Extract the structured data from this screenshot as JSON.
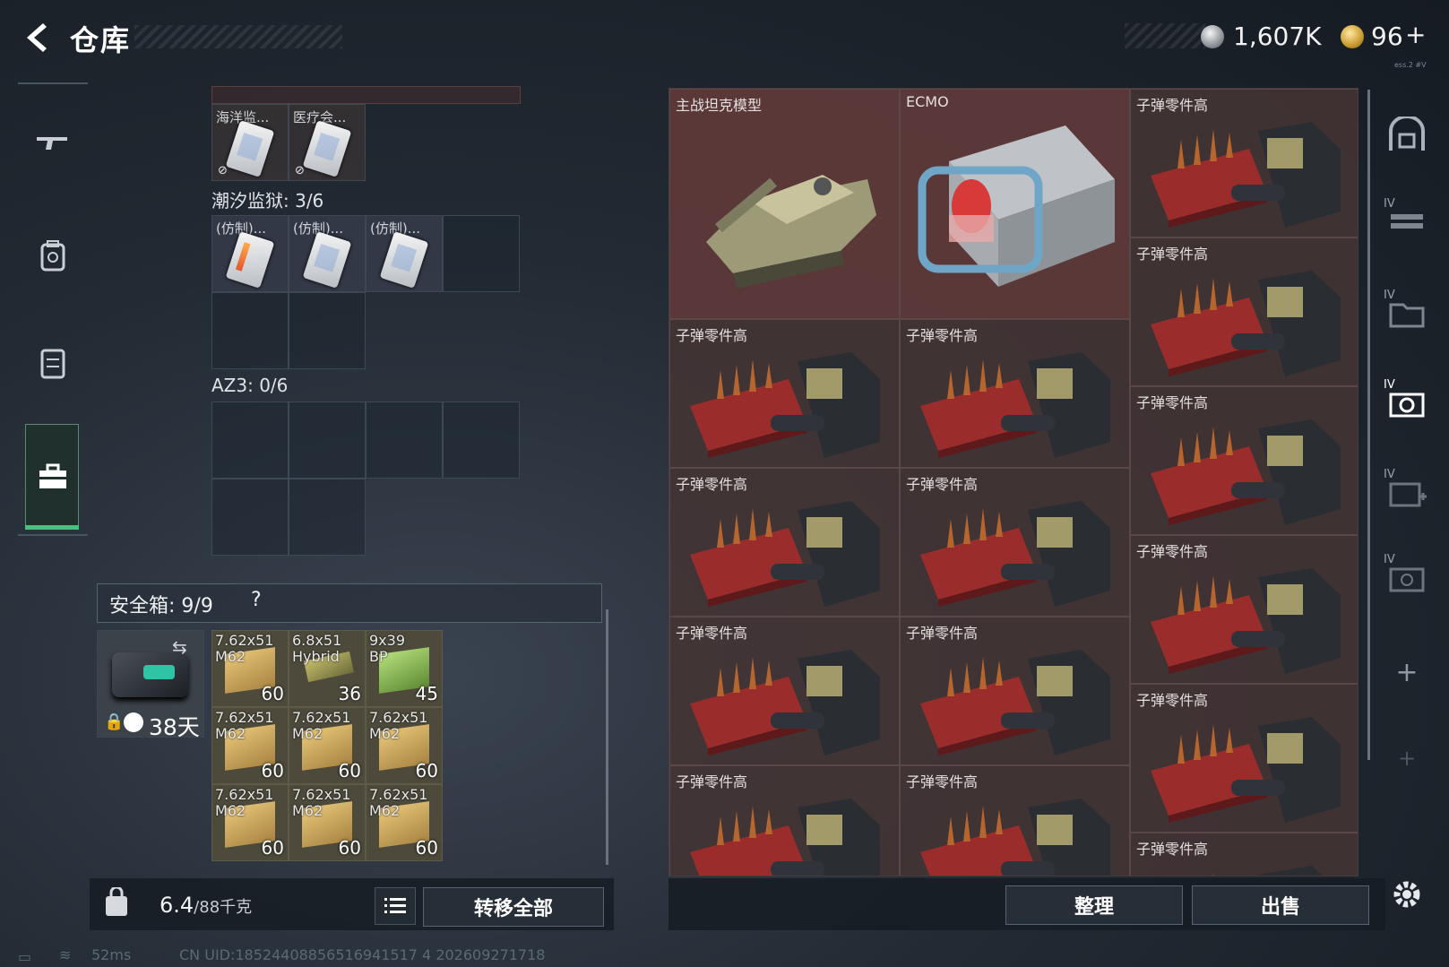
{
  "header": {
    "title": "仓库",
    "currency_silver": "1,607K",
    "currency_gold": "96",
    "gold_plus": "+",
    "version_text": "ess.2 #V"
  },
  "left_nav": {
    "items": [
      "weapon-icon",
      "backpack-icon",
      "vest-icon",
      "toolbox-icon"
    ],
    "active_index": 3
  },
  "containers": {
    "top_row": [
      {
        "label": "海洋监..."
      },
      {
        "label": "医疗会..."
      }
    ],
    "tidal": {
      "title": "潮汐监狱: 3/6",
      "items": [
        {
          "label": "(仿制)..."
        },
        {
          "label": "(仿制)..."
        },
        {
          "label": "(仿制)..."
        }
      ]
    },
    "az3": {
      "title": "AZ3: 0/6"
    }
  },
  "safe_box": {
    "label": "安全箱: 9/9",
    "help": "?",
    "days": "38天",
    "ammo": [
      {
        "name": "7.62x51\nM62",
        "count": "60"
      },
      {
        "name": "6.8x51\nHybrid",
        "count": "36"
      },
      {
        "name": "9x39\nBP",
        "count": "45"
      },
      {
        "name": "7.62x51\nM62",
        "count": "60"
      },
      {
        "name": "7.62x51\nM62",
        "count": "60"
      },
      {
        "name": "7.62x51\nM62",
        "count": "60"
      },
      {
        "name": "7.62x51\nM62",
        "count": "60"
      },
      {
        "name": "7.62x51\nM62",
        "count": "60"
      },
      {
        "name": "7.62x51\nM62",
        "count": "60"
      }
    ]
  },
  "bottom_left": {
    "weight_current": "6.4",
    "weight_max": "/88千克",
    "transfer_all": "转移全部"
  },
  "storage": {
    "tank": "主战坦克模型",
    "ecmo": "ECMO",
    "bullet_parts": "子弹零件高",
    "bullet_parts_count": 14
  },
  "bottom_right": {
    "sort": "整理",
    "sell": "出售"
  },
  "right_nav": {
    "tag": "IV",
    "items": [
      "safe-icon",
      "rack-icon",
      "folder-icon",
      "camera-icon",
      "camera-plus-icon",
      "camera-small-icon",
      "plus-icon",
      "plus-dim-icon"
    ]
  },
  "status": {
    "ping": "52ms",
    "uid": "CN UID:18524408856516941517 4 202609271718"
  },
  "colors": {
    "accent_green": "#48c07e",
    "storage_red": "#5f3a3a",
    "ammo_box": "#4d4a3b"
  }
}
